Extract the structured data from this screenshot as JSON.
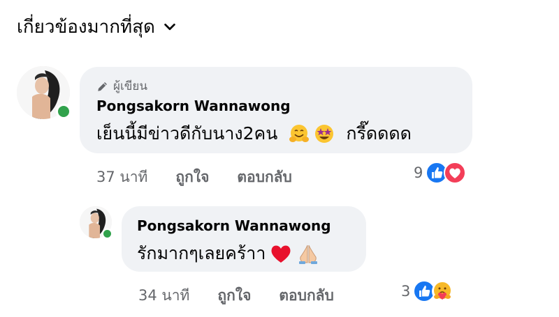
{
  "sort": {
    "label": "เกี่ยวข้องมากที่สุด",
    "icon": "chevron-down-icon"
  },
  "comments": [
    {
      "author_badge": "ผู้เขียน",
      "author": "Pongsakorn Wannawong",
      "text": "เย็นนี้มีข่าวดีกับนาง2คน",
      "emojis": [
        "hugging-face-icon",
        "star-struck-icon"
      ],
      "text_suffix": "กรี๊ดดดด",
      "time": "37 นาที",
      "like_label": "ถูกใจ",
      "reply_label": "ตอบกลับ",
      "reaction_count": "9",
      "reaction_icons": [
        "like-icon",
        "love-icon"
      ],
      "online": true
    },
    {
      "author": "Pongsakorn Wannawong",
      "text": "รักมากๆเลยคร้าา",
      "emojis": [
        "red-heart-icon",
        "folded-hands-icon"
      ],
      "time": "34 นาที",
      "like_label": "ถูกใจ",
      "reply_label": "ตอบกลับ",
      "reaction_count": "3",
      "reaction_icons": [
        "like-icon",
        "care-icon"
      ],
      "online": true
    }
  ],
  "colors": {
    "bubble": "#f0f2f5",
    "secondary_text": "#65676b",
    "online": "#31a24c",
    "like_blue": "#1877f2",
    "love_red": "#f33e58"
  }
}
